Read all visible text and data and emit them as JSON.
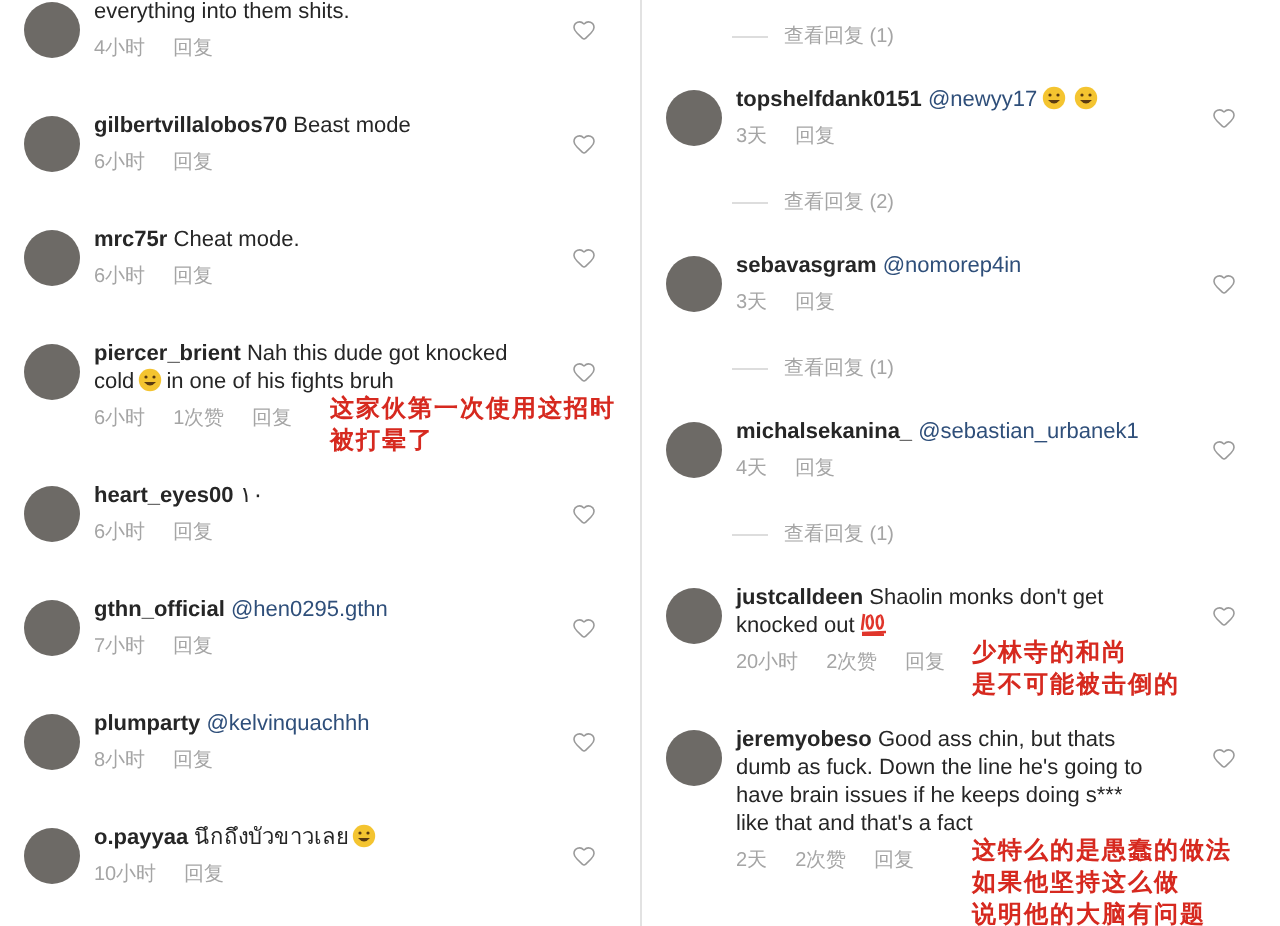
{
  "columns": [
    {
      "items": [
        {
          "kind": "comment",
          "text": "everything into them shits.",
          "time": "4小时",
          "reply": "回复"
        },
        {
          "kind": "comment",
          "user": "gilbertvillalobos70",
          "text": "Beast mode",
          "time": "6小时",
          "reply": "回复"
        },
        {
          "kind": "comment",
          "user": "mrc75r",
          "text": "Cheat mode.",
          "time": "6小时",
          "reply": "回复"
        },
        {
          "kind": "comment",
          "user": "piercer_brient",
          "text": "Nah this dude got knocked cold",
          "emojis": [
            {
              "kind": "laugh"
            }
          ],
          "text_after": "in one of his fights bruh",
          "time": "6小时",
          "likes": "1次赞",
          "reply": "回复",
          "annotation": [
            "这家伙第一次使用这招时",
            "被打晕了"
          ]
        },
        {
          "kind": "comment",
          "user": "heart_eyes00",
          "text": "١٠",
          "time": "6小时",
          "reply": "回复"
        },
        {
          "kind": "comment",
          "user": "gthn_official",
          "mention": "@hen0295.gthn",
          "time": "7小时",
          "reply": "回复"
        },
        {
          "kind": "comment",
          "user": "plumparty",
          "mention": "@kelvinquachhh",
          "time": "8小时",
          "reply": "回复"
        },
        {
          "kind": "comment",
          "user": "o.payyaa",
          "text": "นึกถึงบัวขาวเลย",
          "emojis": [
            {
              "kind": "grin"
            }
          ],
          "time": "10小时",
          "reply": "回复"
        }
      ]
    },
    {
      "items": [
        {
          "kind": "replies",
          "label": "查看回复 (1)"
        },
        {
          "kind": "comment",
          "user": "topshelfdank0151",
          "mention": "@newyy17",
          "emojis": [
            {
              "kind": "laugh"
            },
            {
              "kind": "laugh"
            }
          ],
          "time": "3天",
          "reply": "回复"
        },
        {
          "kind": "replies",
          "label": "查看回复 (2)"
        },
        {
          "kind": "comment",
          "user": "sebavasgram",
          "mention": "@nomorep4in",
          "time": "3天",
          "reply": "回复"
        },
        {
          "kind": "replies",
          "label": "查看回复 (1)"
        },
        {
          "kind": "comment",
          "user": "michalsekanina_",
          "mention": "@sebastian_urbanek1",
          "time": "4天",
          "reply": "回复"
        },
        {
          "kind": "replies",
          "label": "查看回复 (1)"
        },
        {
          "kind": "comment",
          "user": "justcalldeen",
          "text": "Shaolin monks don't get knocked out",
          "emojis": [
            {
              "kind": "hundred"
            }
          ],
          "time": "20小时",
          "likes": "2次赞",
          "reply": "回复",
          "annotation": [
            "少林寺的和尚",
            "是不可能被击倒的"
          ]
        },
        {
          "kind": "comment",
          "user": "jeremyobeso",
          "text": "Good ass chin, but thats dumb as fuck. Down the line he's going to have brain issues if he keeps doing s*** like that and that's a fact",
          "time": "2天",
          "likes": "2次赞",
          "reply": "回复",
          "annotation": [
            "这特么的是愚蠢的做法",
            "如果他坚持这么做",
            "说明他的大脑有问题"
          ]
        }
      ]
    }
  ]
}
